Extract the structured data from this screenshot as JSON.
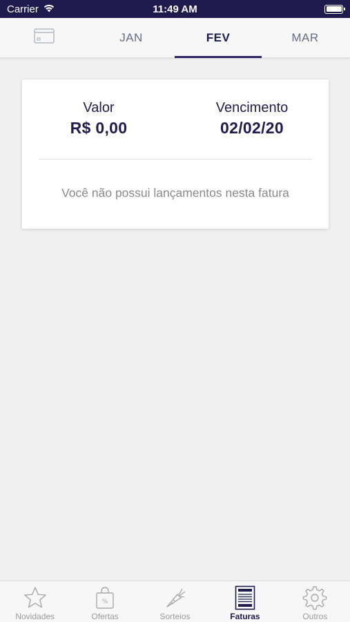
{
  "status_bar": {
    "carrier": "Carrier",
    "time": "11:49 AM"
  },
  "month_tabs": {
    "card_icon": "credit-card-icon",
    "tabs": [
      {
        "label": "JAN",
        "active": false
      },
      {
        "label": "FEV",
        "active": true
      },
      {
        "label": "MAR",
        "active": false
      }
    ]
  },
  "invoice": {
    "value_label": "Valor",
    "value": "R$ 0,00",
    "due_label": "Vencimento",
    "due_date": "02/02/20",
    "empty_message": "Você não possui lançamentos nesta fatura"
  },
  "bottom_nav": {
    "items": [
      {
        "label": "Novidades",
        "icon": "star-icon",
        "active": false
      },
      {
        "label": "Ofertas",
        "icon": "shopping-bag-icon",
        "active": false
      },
      {
        "label": "Sorteios",
        "icon": "carrot-icon",
        "active": false
      },
      {
        "label": "Faturas",
        "icon": "invoice-icon",
        "active": true
      },
      {
        "label": "Outros",
        "icon": "gear-icon",
        "active": false
      }
    ]
  },
  "colors": {
    "brand_dark": "#1f1b4d",
    "inactive": "#9a9a9a",
    "background": "#f0f0f0"
  }
}
